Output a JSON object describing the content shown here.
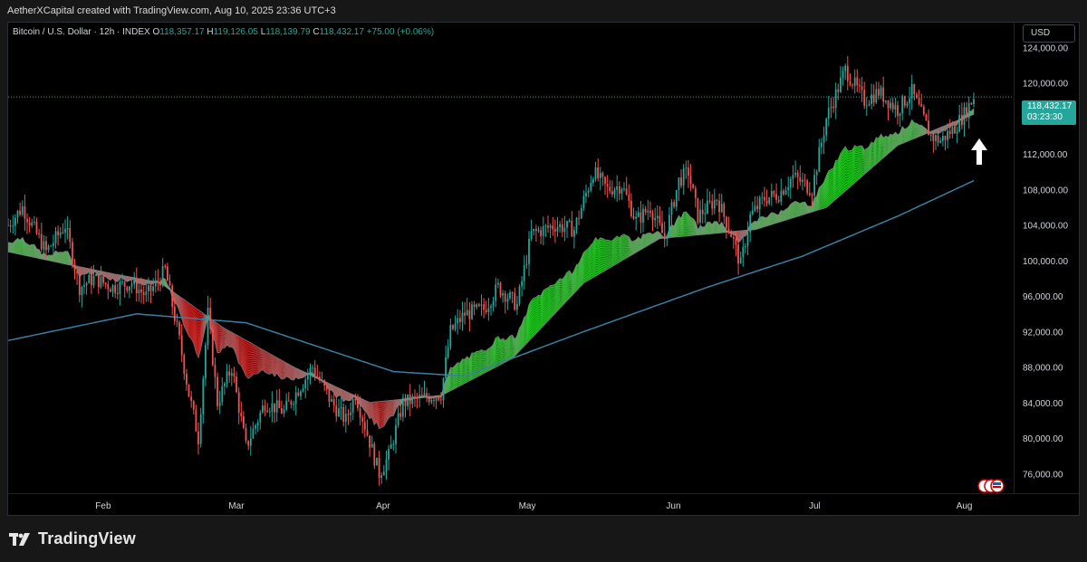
{
  "header": {
    "credit": "AetherXCapital created with TradingView.com, Aug 10, 2025 23:36 UTC+3"
  },
  "legend": {
    "symbol": "Bitcoin / U.S. Dollar · 12h · INDEX",
    "open_label": "O",
    "open": "118,357.17",
    "high_label": "H",
    "high": "119,126.05",
    "low_label": "L",
    "low": "118,139.79",
    "close_label": "C",
    "close": "118,432.17",
    "change": "+75.00 (+0.06%)"
  },
  "currency_button": "USD",
  "last_price": {
    "price": "118,432.17",
    "countdown": "03:23:30"
  },
  "footer": {
    "brand": "TradingView"
  },
  "colors": {
    "up": "#26a69a",
    "down": "#ef5350",
    "ma200": "#3b7fa3",
    "ribbon_bull": "#00e000",
    "ribbon_bear": "#e00000",
    "background": "#000000"
  },
  "icons": [
    "tradingview-logo-icon",
    "up-arrow-icon",
    "event-flags-icon"
  ],
  "chart_data": {
    "type": "candlestick",
    "interval": "12h",
    "y_axis_labels": [
      "124,000.00",
      "120,000.00",
      "116,000.00",
      "112,000.00",
      "108,000.00",
      "104,000.00",
      "100,000.00",
      "96,000.00",
      "92,000.00",
      "88,000.00",
      "84,000.00",
      "80,000.00",
      "76,000.00"
    ],
    "y_ticks": [
      124000,
      120000,
      116000,
      112000,
      108000,
      104000,
      100000,
      96000,
      92000,
      88000,
      84000,
      80000,
      76000
    ],
    "ylim": [
      73800,
      126800
    ],
    "x_labels": [
      "Feb",
      "Mar",
      "Apr",
      "May",
      "Jun",
      "Jul",
      "Aug"
    ],
    "x_label_dates": [
      "2025-02-01",
      "2025-03-01",
      "2025-04-01",
      "2025-05-01",
      "2025-06-01",
      "2025-07-01",
      "2025-08-01"
    ],
    "date_range": [
      "2025-01-19",
      "2025-08-10"
    ],
    "price_path": [
      [
        "2025-01-19",
        104000
      ],
      [
        "2025-01-22",
        106000
      ],
      [
        "2025-01-27",
        101000
      ],
      [
        "2025-01-31",
        104000
      ],
      [
        "2025-02-03",
        97000
      ],
      [
        "2025-02-06",
        98000
      ],
      [
        "2025-02-10",
        97000
      ],
      [
        "2025-02-14",
        97500
      ],
      [
        "2025-02-17",
        96000
      ],
      [
        "2025-02-20",
        98000
      ],
      [
        "2025-02-21",
        99000
      ],
      [
        "2025-02-24",
        91000
      ],
      [
        "2025-02-26",
        85000
      ],
      [
        "2025-02-28",
        80000
      ],
      [
        "2025-03-02",
        94000
      ],
      [
        "2025-03-04",
        84000
      ],
      [
        "2025-03-07",
        88000
      ],
      [
        "2025-03-10",
        79000
      ],
      [
        "2025-03-14",
        84000
      ],
      [
        "2025-03-18",
        83000
      ],
      [
        "2025-03-24",
        88000
      ],
      [
        "2025-03-28",
        84000
      ],
      [
        "2025-03-31",
        82000
      ],
      [
        "2025-04-02",
        85000
      ],
      [
        "2025-04-07",
        76000
      ],
      [
        "2025-04-09",
        78000
      ],
      [
        "2025-04-12",
        84000
      ],
      [
        "2025-04-16",
        84500
      ],
      [
        "2025-04-20",
        85000
      ],
      [
        "2025-04-22",
        92000
      ],
      [
        "2025-04-25",
        94000
      ],
      [
        "2025-04-29",
        94500
      ],
      [
        "2025-05-02",
        97000
      ],
      [
        "2025-05-06",
        95000
      ],
      [
        "2025-05-09",
        103000
      ],
      [
        "2025-05-14",
        104000
      ],
      [
        "2025-05-18",
        103500
      ],
      [
        "2025-05-22",
        110000
      ],
      [
        "2025-05-25",
        108000
      ],
      [
        "2025-05-28",
        108500
      ],
      [
        "2025-05-31",
        104500
      ],
      [
        "2025-06-03",
        106000
      ],
      [
        "2025-06-06",
        102500
      ],
      [
        "2025-06-09",
        109000
      ],
      [
        "2025-06-11",
        110000
      ],
      [
        "2025-06-13",
        105000
      ],
      [
        "2025-06-17",
        107000
      ],
      [
        "2025-06-20",
        103000
      ],
      [
        "2025-06-22",
        99500
      ],
      [
        "2025-06-24",
        105000
      ],
      [
        "2025-06-27",
        107000
      ],
      [
        "2025-06-30",
        107500
      ],
      [
        "2025-07-03",
        109500
      ],
      [
        "2025-07-07",
        108000
      ],
      [
        "2025-07-10",
        116000
      ],
      [
        "2025-07-14",
        121500
      ],
      [
        "2025-07-18",
        118000
      ],
      [
        "2025-07-21",
        119000
      ],
      [
        "2025-07-25",
        117000
      ],
      [
        "2025-07-28",
        119000
      ],
      [
        "2025-08-01",
        114000
      ],
      [
        "2025-08-03",
        113500
      ],
      [
        "2025-08-06",
        115000
      ],
      [
        "2025-08-08",
        116500
      ],
      [
        "2025-08-10",
        118432
      ]
    ],
    "ma200_path": [
      [
        "2025-01-19",
        91000
      ],
      [
        "2025-02-15",
        94000
      ],
      [
        "2025-03-10",
        93000
      ],
      [
        "2025-04-10",
        87500
      ],
      [
        "2025-04-25",
        87000
      ],
      [
        "2025-05-20",
        92000
      ],
      [
        "2025-06-15",
        97000
      ],
      [
        "2025-07-05",
        100500
      ],
      [
        "2025-07-25",
        105000
      ],
      [
        "2025-08-10",
        109000
      ]
    ],
    "ribbon_slow_path": [
      [
        "2025-01-19",
        101000
      ],
      [
        "2025-02-10",
        98500
      ],
      [
        "2025-02-20",
        97500
      ],
      [
        "2025-03-05",
        92500
      ],
      [
        "2025-03-20",
        88000
      ],
      [
        "2025-04-05",
        84000
      ],
      [
        "2025-04-20",
        84800
      ],
      [
        "2025-05-05",
        89000
      ],
      [
        "2025-05-20",
        97500
      ],
      [
        "2025-06-05",
        102500
      ],
      [
        "2025-06-25",
        103500
      ],
      [
        "2025-07-10",
        106000
      ],
      [
        "2025-07-25",
        113000
      ],
      [
        "2025-08-10",
        116500
      ]
    ]
  }
}
